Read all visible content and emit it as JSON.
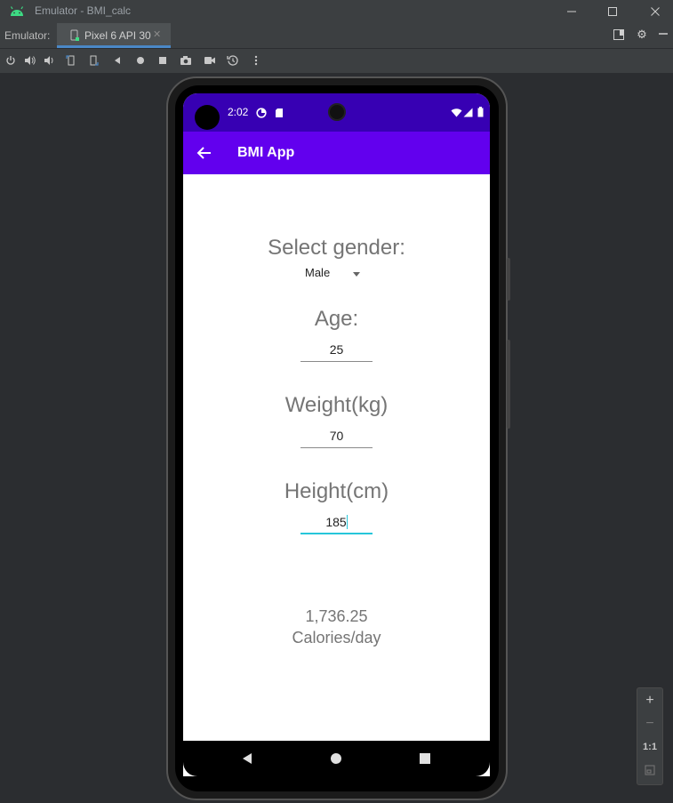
{
  "window": {
    "title": "Emulator - BMI_calc"
  },
  "tabbar": {
    "label": "Emulator:",
    "device_tab": "Pixel 6 API 30"
  },
  "status_bar": {
    "time": "2:02"
  },
  "app_bar": {
    "title": "BMI App"
  },
  "form": {
    "gender_label": "Select gender:",
    "gender_value": "Male",
    "age_label": "Age:",
    "age_value": "25",
    "weight_label": "Weight(kg)",
    "weight_value": "70",
    "height_label": "Height(cm)",
    "height_value": "185"
  },
  "result": {
    "value": "1,736.25",
    "unit": "Calories/day"
  },
  "zoom": {
    "plus": "+",
    "minus": "−",
    "one_to_one": "1:1"
  },
  "colors": {
    "status_bar": "#3700b3",
    "app_bar": "#6200ee",
    "focus_accent": "#26c6da"
  }
}
